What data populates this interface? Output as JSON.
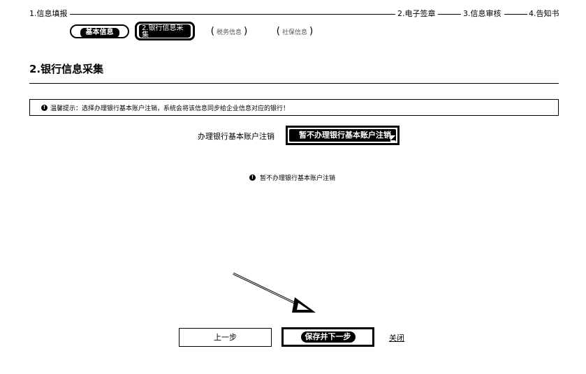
{
  "steps": [
    {
      "label": "1.信息填报"
    },
    {
      "label": "2.电子签章"
    },
    {
      "label": "3.信息审核"
    },
    {
      "label": "4.告知书"
    }
  ],
  "subtabs": [
    {
      "label": "基本信息"
    },
    {
      "label": "2.银行信息采集"
    },
    {
      "label": "税务信息"
    },
    {
      "label": "社保信息"
    }
  ],
  "section": {
    "title": "2.银行信息采集"
  },
  "notice": {
    "icon": "info-icon",
    "text": "温馨提示：选择办理银行基本账户注销，系统会将该信息同步给企业信息对应的银行！"
  },
  "form": {
    "field_label": "办理银行基本账户注销",
    "selected_value": "暂不办理银行基本账户注销",
    "hint": "暂不办理银行基本账户注销"
  },
  "buttons": {
    "prev": "上一步",
    "save_next": "保存并下一步",
    "close": "关闭"
  },
  "colors": {
    "primary": "#000000",
    "background": "#ffffff"
  }
}
